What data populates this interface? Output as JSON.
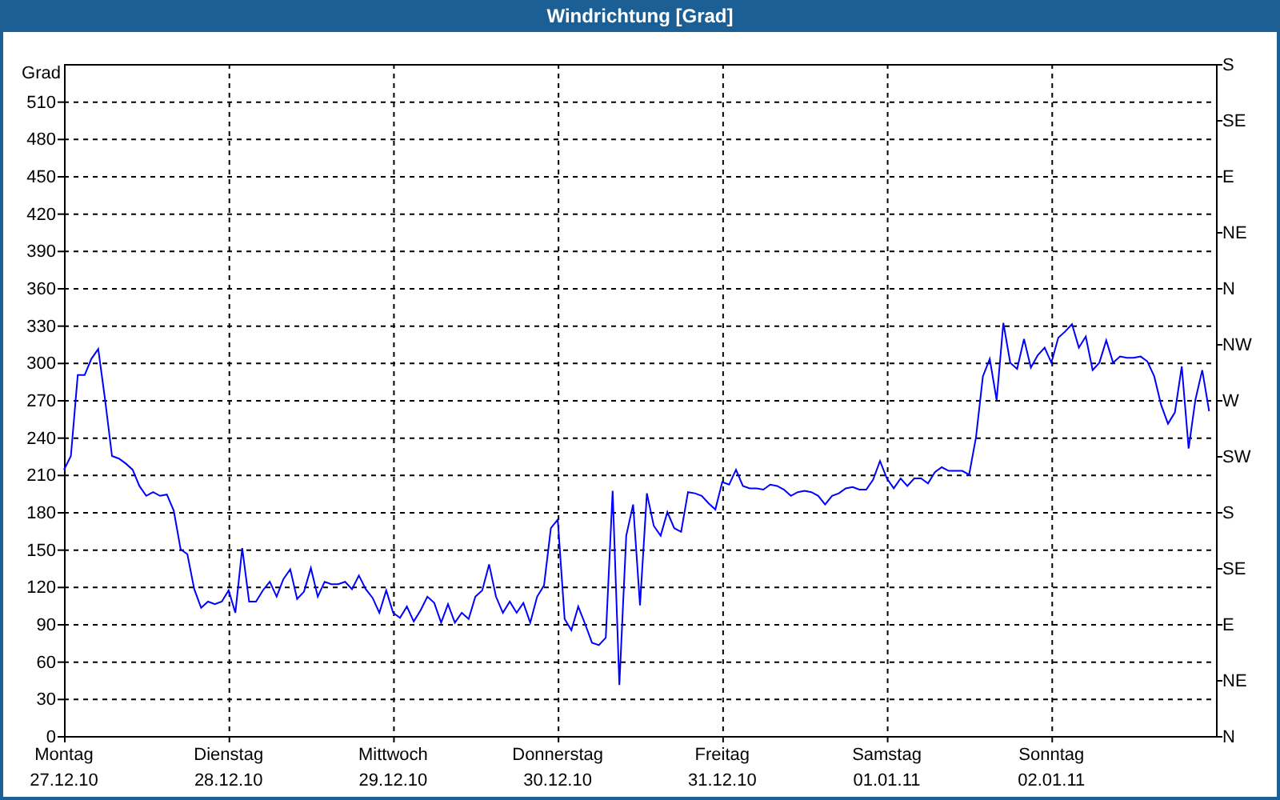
{
  "window": {
    "title": "Windrichtung [Grad]"
  },
  "chart": {
    "compass_ticks": [
      "S",
      "SE",
      "E",
      "NE",
      "N",
      "NW",
      "W",
      "SW",
      "S",
      "SE",
      "E",
      "NE",
      "N"
    ],
    "chart_data": {
      "type": "line",
      "grid": true,
      "ylabel": "Grad",
      "ylim": [
        0,
        540
      ],
      "yticks": [
        0,
        30,
        60,
        90,
        120,
        150,
        180,
        210,
        240,
        270,
        300,
        330,
        360,
        390,
        420,
        450,
        480,
        510
      ],
      "categories": [
        "Montag 27.12.10",
        null,
        null,
        null,
        null,
        null,
        null,
        null,
        null,
        null,
        null,
        null,
        null,
        null,
        null,
        null,
        null,
        null,
        null,
        null,
        null,
        null,
        null,
        null,
        "Dienstag 28.12.10",
        null,
        null,
        null,
        null,
        null,
        null,
        null,
        null,
        null,
        null,
        null,
        null,
        null,
        null,
        null,
        null,
        null,
        null,
        null,
        null,
        null,
        null,
        null,
        "Mittwoch 29.12.10",
        null,
        null,
        null,
        null,
        null,
        null,
        null,
        null,
        null,
        null,
        null,
        null,
        null,
        null,
        null,
        null,
        null,
        null,
        null,
        null,
        null,
        null,
        null,
        "Donnerstag 30.12.10",
        null,
        null,
        null,
        null,
        null,
        null,
        null,
        null,
        null,
        null,
        null,
        null,
        null,
        null,
        null,
        null,
        null,
        null,
        null,
        null,
        null,
        null,
        null,
        "Freitag 31.12.10",
        null,
        null,
        null,
        null,
        null,
        null,
        null,
        null,
        null,
        null,
        null,
        null,
        null,
        null,
        null,
        null,
        null,
        null,
        null,
        null,
        null,
        null,
        null,
        "Samstag 01.01.11",
        null,
        null,
        null,
        null,
        null,
        null,
        null,
        null,
        null,
        null,
        null,
        null,
        null,
        null,
        null,
        null,
        null,
        null,
        null,
        null,
        null,
        null,
        null,
        "Sonntag 02.01.11",
        null,
        null,
        null,
        null,
        null,
        null,
        null,
        null,
        null,
        null,
        null,
        null,
        null,
        null,
        null,
        null,
        null,
        null,
        null,
        null,
        null,
        null,
        null
      ],
      "series": [
        {
          "color": "#0000ff",
          "values": [
            214,
            225,
            290,
            290,
            303,
            311,
            270,
            225,
            223,
            219,
            214,
            201,
            193,
            196,
            193,
            194,
            181,
            150,
            146,
            118,
            103,
            108,
            106,
            108,
            117,
            99,
            151,
            108,
            108,
            117,
            124,
            112,
            126,
            134,
            110,
            116,
            135,
            112,
            124,
            122,
            122,
            124,
            118,
            129,
            118,
            111,
            99,
            117,
            99,
            95,
            104,
            92,
            101,
            112,
            107,
            91,
            106,
            91,
            99,
            94,
            112,
            117,
            138,
            112,
            99,
            108,
            99,
            107,
            91,
            112,
            121,
            167,
            174,
            94,
            85,
            104,
            90,
            75,
            73,
            79,
            197,
            41,
            161,
            186,
            105,
            195,
            169,
            161,
            180,
            167,
            164,
            196,
            195,
            193,
            187,
            182,
            204,
            202,
            214,
            201,
            199,
            199,
            198,
            202,
            201,
            198,
            193,
            196,
            197,
            196,
            193,
            186,
            193,
            195,
            199,
            200,
            198,
            198,
            206,
            221,
            207,
            199,
            207,
            201,
            207,
            207,
            203,
            212,
            216,
            213,
            213,
            213,
            210,
            240,
            289,
            303,
            270,
            332,
            300,
            295,
            319,
            296,
            306,
            312,
            300,
            320,
            325,
            331,
            312,
            321,
            294,
            300,
            318,
            300,
            305,
            304,
            304,
            305,
            301,
            289,
            266,
            251,
            260,
            297,
            231,
            270,
            294,
            261
          ]
        }
      ]
    }
  }
}
